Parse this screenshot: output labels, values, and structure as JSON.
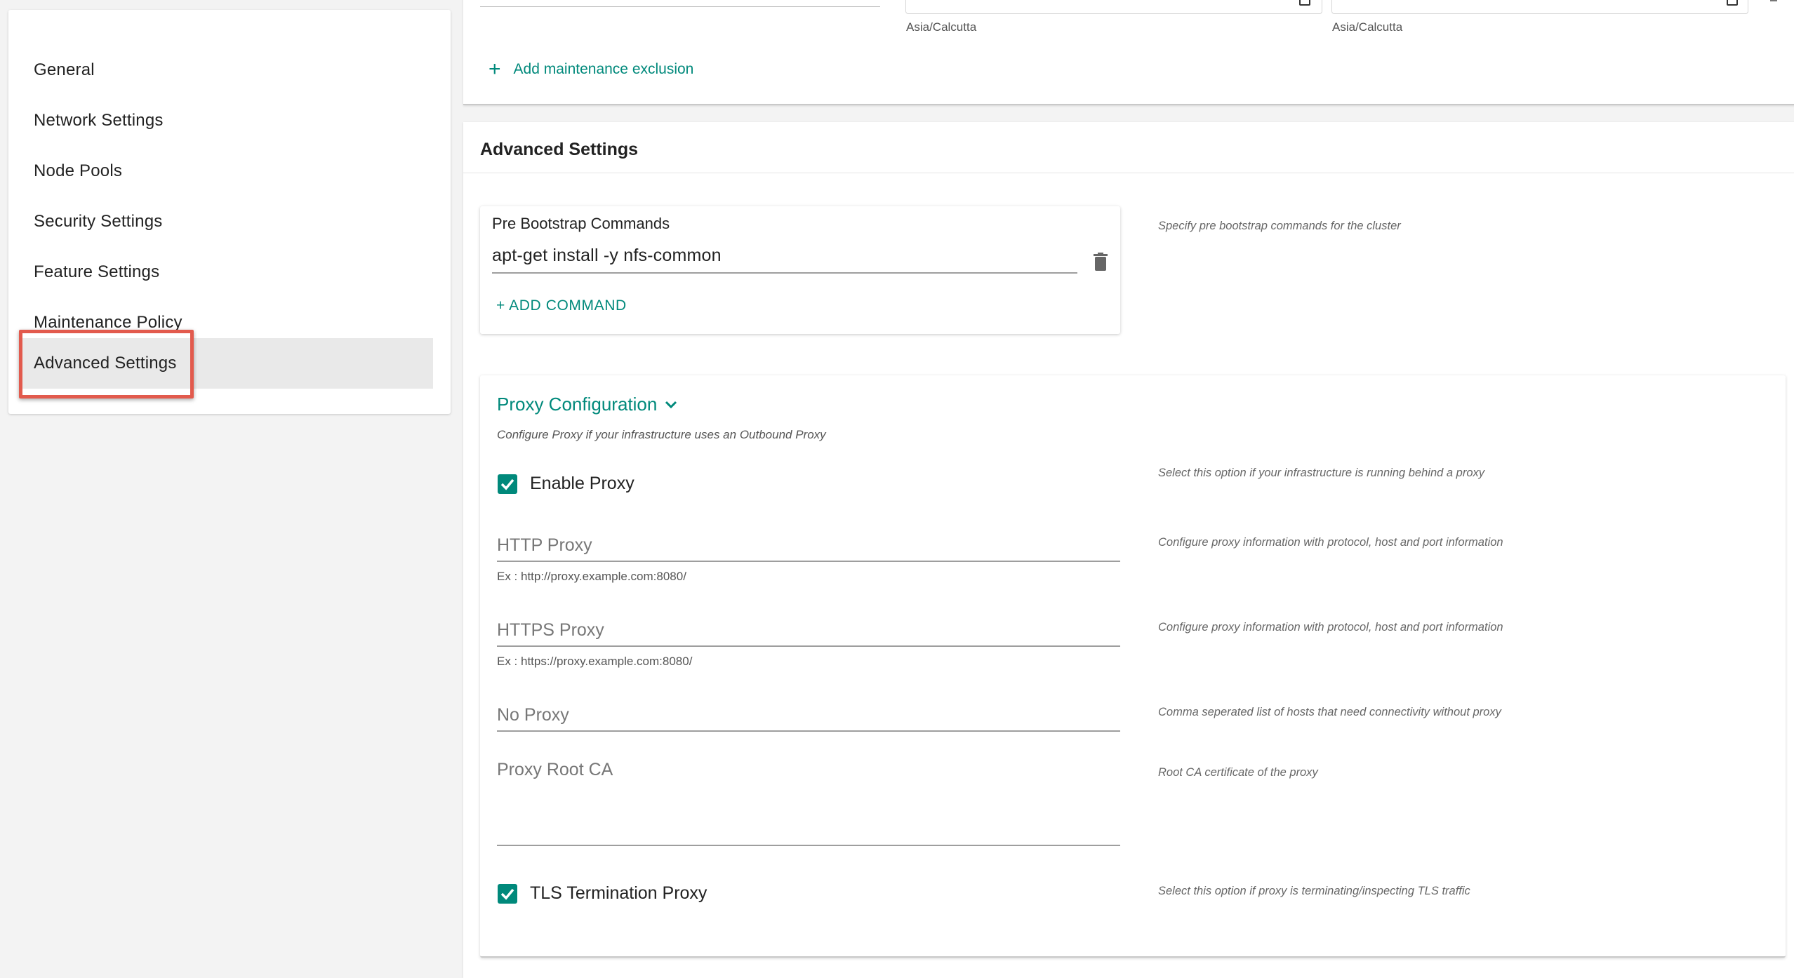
{
  "sidebar": {
    "items": [
      {
        "label": "General"
      },
      {
        "label": "Network Settings"
      },
      {
        "label": "Node Pools"
      },
      {
        "label": "Security Settings"
      },
      {
        "label": "Feature Settings"
      },
      {
        "label": "Maintenance Policy"
      },
      {
        "label": "Advanced Settings",
        "active": true
      }
    ]
  },
  "maintenance": {
    "timezone_start": "Asia/Calcutta",
    "timezone_end": "Asia/Calcutta",
    "add_exclusion_label": "Add maintenance exclusion"
  },
  "advanced": {
    "title": "Advanced Settings",
    "pre_bootstrap": {
      "title": "Pre Bootstrap Commands",
      "commands": [
        "apt-get install -y nfs-common"
      ],
      "add_command_label": "+ ADD  COMMAND",
      "help": "Specify pre bootstrap commands for the cluster"
    },
    "proxy": {
      "title": "Proxy Configuration",
      "subtitle": "Configure Proxy if your infrastructure uses an Outbound Proxy",
      "enable_proxy": {
        "label": "Enable Proxy",
        "checked": true,
        "help": "Select this option if your infrastructure is running behind a proxy"
      },
      "http_proxy": {
        "label": "HTTP Proxy",
        "value": "",
        "hint": "Ex : http://proxy.example.com:8080/",
        "help": "Configure proxy information with protocol, host and port information"
      },
      "https_proxy": {
        "label": "HTTPS Proxy",
        "value": "",
        "hint": "Ex : https://proxy.example.com:8080/",
        "help": "Configure proxy information with protocol, host and port information"
      },
      "no_proxy": {
        "label": "No Proxy",
        "value": "",
        "help": "Comma seperated list of hosts that need connectivity without proxy"
      },
      "root_ca": {
        "label": "Proxy Root CA",
        "value": "",
        "help": "Root CA certificate of the proxy"
      },
      "tls_termination": {
        "label": "TLS Termination Proxy",
        "checked": true,
        "help": "Select this option if proxy is terminating/inspecting TLS traffic"
      }
    }
  },
  "colors": {
    "accent": "#00897b",
    "highlight": "#e25a4d"
  }
}
